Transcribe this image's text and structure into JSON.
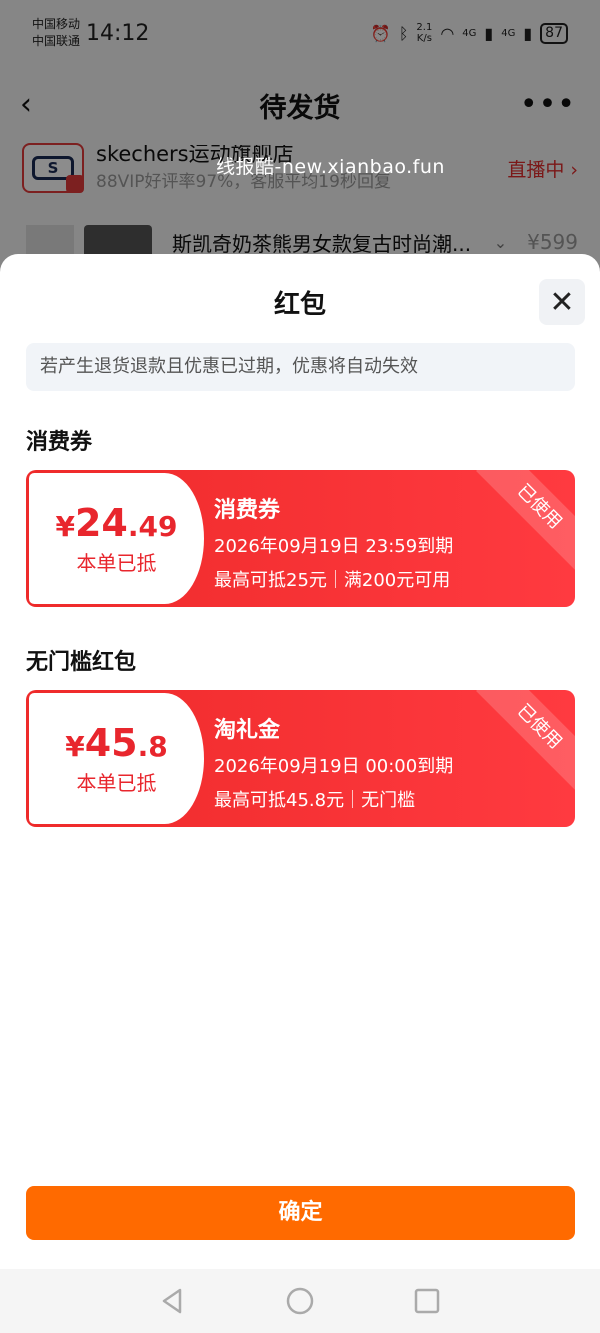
{
  "status_bar": {
    "carrier1": "中国移动",
    "carrier2": "中国联通",
    "time": "14:12",
    "net_speed_value": "2.1",
    "net_speed_unit": "K/s",
    "signal1": "4G",
    "signal2": "4G",
    "battery": "87"
  },
  "nav": {
    "title": "待发货",
    "more": "•••"
  },
  "shop": {
    "name": "skechers运动旗舰店",
    "subtitle": "88VIP好评率97%，客服平均19秒回复",
    "live": "直播中 ›"
  },
  "watermark": "线报酷-new.xianbao.fun",
  "product": {
    "name": "斯凯奇奶茶熊男女款复古时尚潮...",
    "price": "¥599"
  },
  "sheet": {
    "title": "红包",
    "notice": "若产生退货退款且优惠已过期，优惠将自动失效",
    "section_consumer": "消费券",
    "section_nothreshold": "无门槛红包",
    "confirm": "确定"
  },
  "coupons": [
    {
      "currency": "¥",
      "amount_int": "24",
      "amount_dec": ".49",
      "applied": "本单已抵",
      "name": "消费券",
      "expiry": "2026年09月19日 23:59到期",
      "max": "最高可抵25元",
      "condition": "满200元可用",
      "badge": "已使用"
    },
    {
      "currency": "¥",
      "amount_int": "45",
      "amount_dec": ".8",
      "applied": "本单已抵",
      "name": "淘礼金",
      "expiry": "2026年09月19日 00:00到期",
      "max": "最高可抵45.8元",
      "condition": "无门槛",
      "badge": "已使用"
    }
  ],
  "colors": {
    "coupon_red": "#ee2a2a",
    "amount_red": "#e8262d",
    "confirm_orange": "#ff6a00"
  }
}
